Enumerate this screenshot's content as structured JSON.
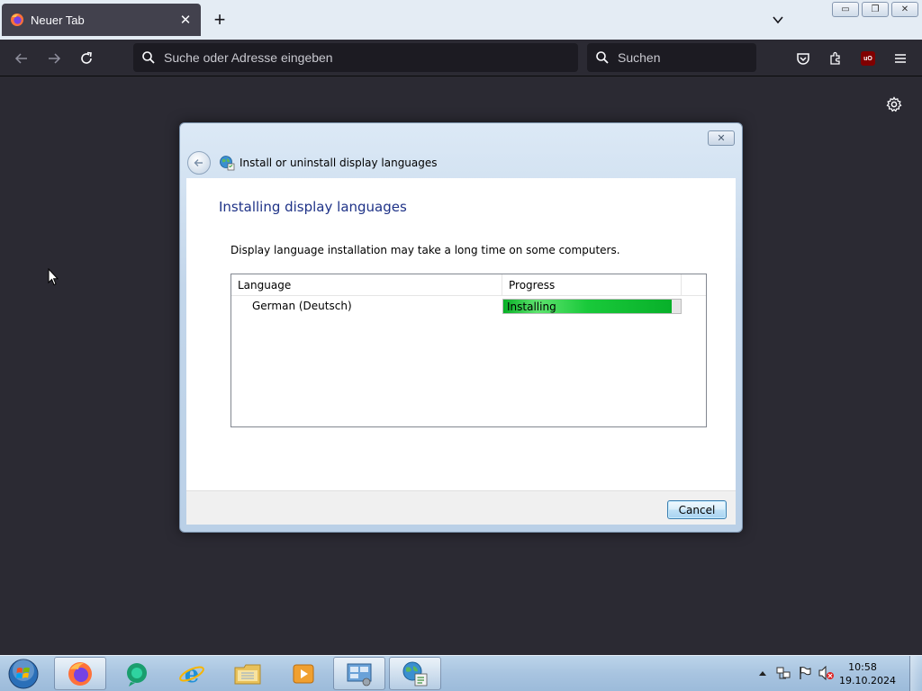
{
  "browser": {
    "tab_title": "Neuer Tab",
    "tab_close_glyph": "✕",
    "new_tab_glyph": "+",
    "url_placeholder": "Suche oder Adresse eingeben",
    "search_placeholder": "Suchen",
    "ublock_label": "uO",
    "icons": [
      "firefox-icon",
      "back-arrow-icon",
      "forward-arrow-icon",
      "reload-icon",
      "search-icon",
      "pocket-icon",
      "extensions-icon",
      "ublock-icon",
      "hamburger-menu-icon",
      "gear-icon",
      "chevron-down-icon"
    ]
  },
  "window_controls": {
    "minimize": "▭",
    "restore": "❐",
    "close": "✕"
  },
  "dialog": {
    "close_glyph": "✕",
    "title": "Install or uninstall display languages",
    "heading": "Installing display languages",
    "description": "Display language installation may take a long time on some computers.",
    "table": {
      "columns": [
        "Language",
        "Progress"
      ],
      "rows": [
        {
          "language": "German (Deutsch)",
          "status": "Installing",
          "progress_fraction": 0.95
        }
      ]
    },
    "cancel_label": "Cancel",
    "colors": {
      "heading": "#1e3287",
      "progress": "#06b025"
    }
  },
  "taskbar": {
    "items": [
      "windows-start-orb",
      "firefox-icon",
      "messenger-icon",
      "internet-explorer-icon",
      "file-explorer-icon",
      "media-player-icon",
      "control-panel-icon",
      "display-language-icon"
    ],
    "time": "10:58",
    "date": "19.10.2024"
  }
}
